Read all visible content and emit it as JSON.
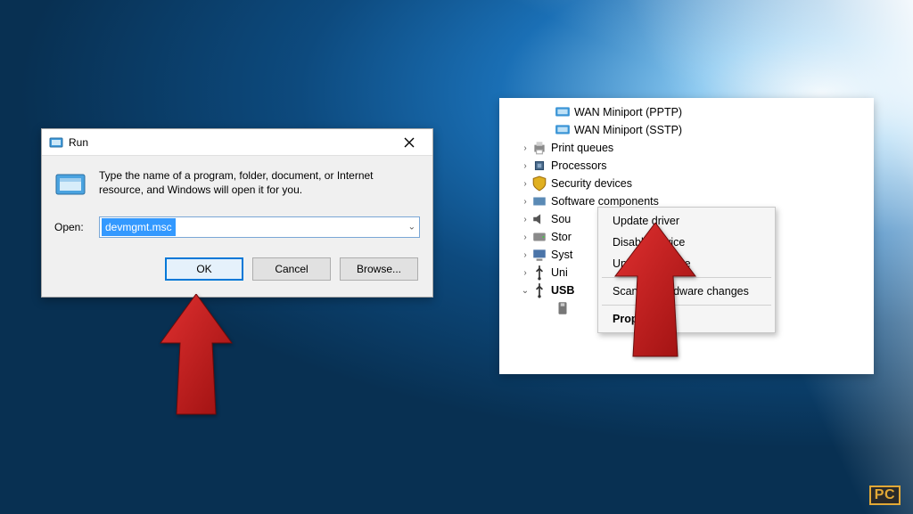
{
  "run": {
    "title": "Run",
    "message": "Type the name of a program, folder, document, or Internet resource, and Windows will open it for you.",
    "open_label": "Open:",
    "combo_value": "devmgmt.msc",
    "buttons": {
      "ok": "OK",
      "cancel": "Cancel",
      "browse": "Browse..."
    }
  },
  "devmgr": {
    "items": [
      {
        "label": "WAN Miniport (PPTP)",
        "arrow": "none",
        "indent": 2,
        "icon": "net"
      },
      {
        "label": "WAN Miniport (SSTP)",
        "arrow": "none",
        "indent": 2,
        "icon": "net"
      },
      {
        "label": "Print queues",
        "arrow": "closed",
        "indent": 1,
        "icon": "printer"
      },
      {
        "label": "Processors",
        "arrow": "closed",
        "indent": 1,
        "icon": "cpu"
      },
      {
        "label": "Security devices",
        "arrow": "closed",
        "indent": 1,
        "icon": "shield"
      },
      {
        "label": "Software components",
        "arrow": "closed",
        "indent": 1,
        "icon": "sw"
      },
      {
        "label": "Sou",
        "arrow": "closed",
        "indent": 1,
        "icon": "sound"
      },
      {
        "label": "Stor",
        "arrow": "closed",
        "indent": 1,
        "icon": "disk"
      },
      {
        "label": "Syst",
        "arrow": "closed",
        "indent": 1,
        "icon": "sys"
      },
      {
        "label": "Uni",
        "arrow": "closed",
        "indent": 1,
        "icon": "usb"
      },
      {
        "label": "USB",
        "arrow": "open",
        "indent": 1,
        "icon": "usb"
      },
      {
        "label": "",
        "arrow": "none",
        "indent": 2,
        "icon": "usb-dev"
      }
    ]
  },
  "ctx": {
    "update": "Update driver",
    "disable": "Disable device",
    "uninstall": "Uninstall device",
    "scan": "Scan for hardware changes",
    "properties": "Properties"
  },
  "watermark": {
    "pc": "PC"
  }
}
